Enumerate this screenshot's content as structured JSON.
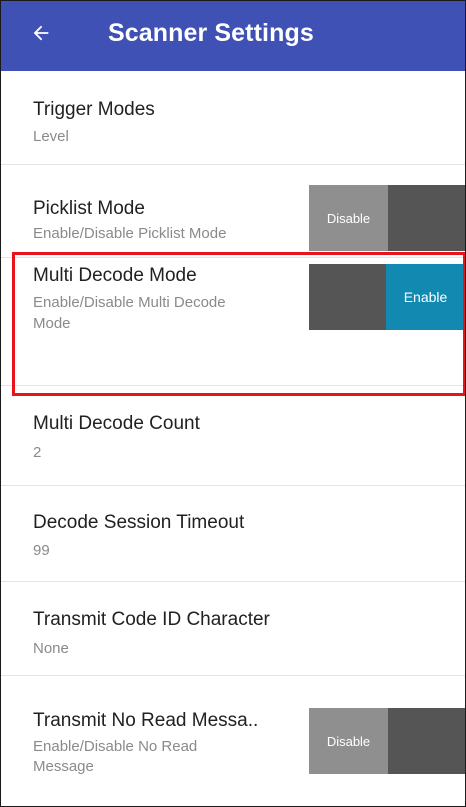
{
  "colors": {
    "appbar": "#3f51b5",
    "toggle_off": "#8f8f8f",
    "toggle_track": "#555555",
    "toggle_on": "#1189b0",
    "highlight": "#e8141a"
  },
  "appbar": {
    "back_icon": "arrow-left-icon",
    "title": "Scanner Settings"
  },
  "settings": [
    {
      "title": "Trigger Modes",
      "subtitle": "Level"
    },
    {
      "title": "Picklist Mode",
      "subtitle": "Enable/Disable Picklist Mode",
      "toggle_label": "Disable",
      "state": "off"
    },
    {
      "title": "Multi Decode Mode",
      "subtitle_line1": "Enable/Disable Multi Decode",
      "subtitle_line2": "Mode",
      "toggle_label": "Enable",
      "state": "on"
    },
    {
      "title": "Multi Decode Count",
      "subtitle": "2"
    },
    {
      "title": "Decode Session Timeout",
      "subtitle": "99"
    },
    {
      "title": "Transmit Code ID Character",
      "subtitle": "None"
    },
    {
      "title": "Transmit No Read Messa..",
      "subtitle_line1": "Enable/Disable No Read",
      "subtitle_line2": "Message",
      "toggle_label": "Disable",
      "state": "off"
    }
  ]
}
